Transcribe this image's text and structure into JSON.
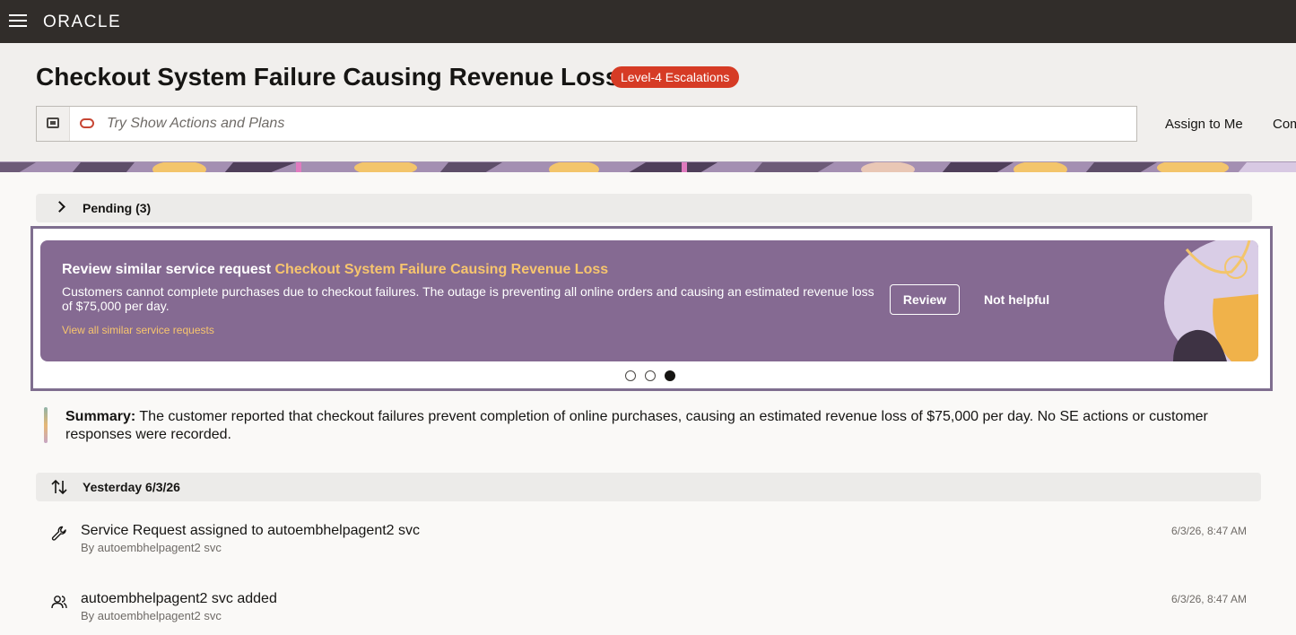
{
  "topbar": {
    "brand": "ORACLE"
  },
  "header": {
    "title": "Checkout System Failure Causing Revenue Loss",
    "badge": "Level-4 Escalations",
    "search_placeholder": "Try Show Actions and Plans",
    "actions": [
      "Assign to Me",
      "Com"
    ]
  },
  "pending": {
    "label": "Pending (3)"
  },
  "suggestion": {
    "title_prefix": "Review similar service request",
    "title_highlight": "Checkout System Failure Causing Revenue Loss",
    "description": "Customers cannot complete purchases due to checkout failures. The outage is preventing all online orders and causing an estimated revenue loss of $75,000 per day.",
    "link": "View all similar service requests",
    "review_label": "Review",
    "not_helpful_label": "Not helpful",
    "carousel": {
      "count": 3,
      "active": 3
    }
  },
  "summary": {
    "label": "Summary:",
    "text": "The customer reported that checkout failures prevent completion of online purchases, causing an estimated revenue loss of $75,000 per day. No SE actions or customer responses were recorded."
  },
  "timeline": {
    "group_label": "Yesterday 6/3/26",
    "items": [
      {
        "icon": "wrench-icon",
        "title": "Service Request assigned to autoembhelpagent2 svc",
        "by": "By autoembhelpagent2 svc",
        "time": "6/3/26, 8:47 AM"
      },
      {
        "icon": "users-icon",
        "title": "autoembhelpagent2 svc added",
        "by": "By autoembhelpagent2 svc",
        "time": "6/3/26, 8:47 AM"
      }
    ]
  },
  "colors": {
    "topbar": "#312d2a",
    "badge": "#d63b25",
    "card": "#856a92",
    "highlight": "#f7c56e",
    "frame": "#7f6e8f"
  }
}
